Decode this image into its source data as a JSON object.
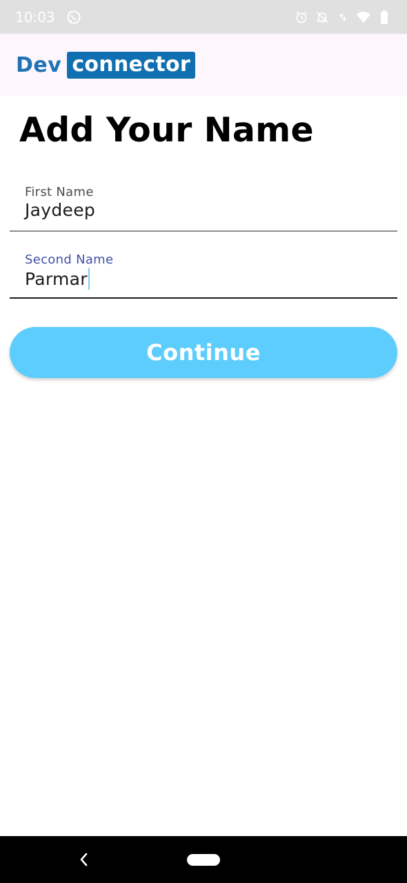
{
  "status_bar": {
    "time": "10:03",
    "left_icons": [
      "whatsapp-icon"
    ],
    "right_icons": [
      "alarm-icon",
      "notifications-off-icon",
      "data-arrows-icon",
      "wifi-icon",
      "battery-icon"
    ],
    "background": "#e0e0e0"
  },
  "app_bar": {
    "logo_dev": "Dev",
    "logo_connector": "connector",
    "logo_color": "#0f6fb0"
  },
  "page": {
    "title": "Add Your Name"
  },
  "form": {
    "first_name": {
      "label": "First Name",
      "value": "Jaydeep"
    },
    "second_name": {
      "label": "Second Name",
      "value": "Parmar",
      "focused": true,
      "label_color": "#3f51a5"
    }
  },
  "actions": {
    "continue_label": "Continue",
    "continue_color": "#5ccdfd"
  },
  "nav_bar": {
    "buttons": [
      "back-icon",
      "home-pill"
    ]
  }
}
